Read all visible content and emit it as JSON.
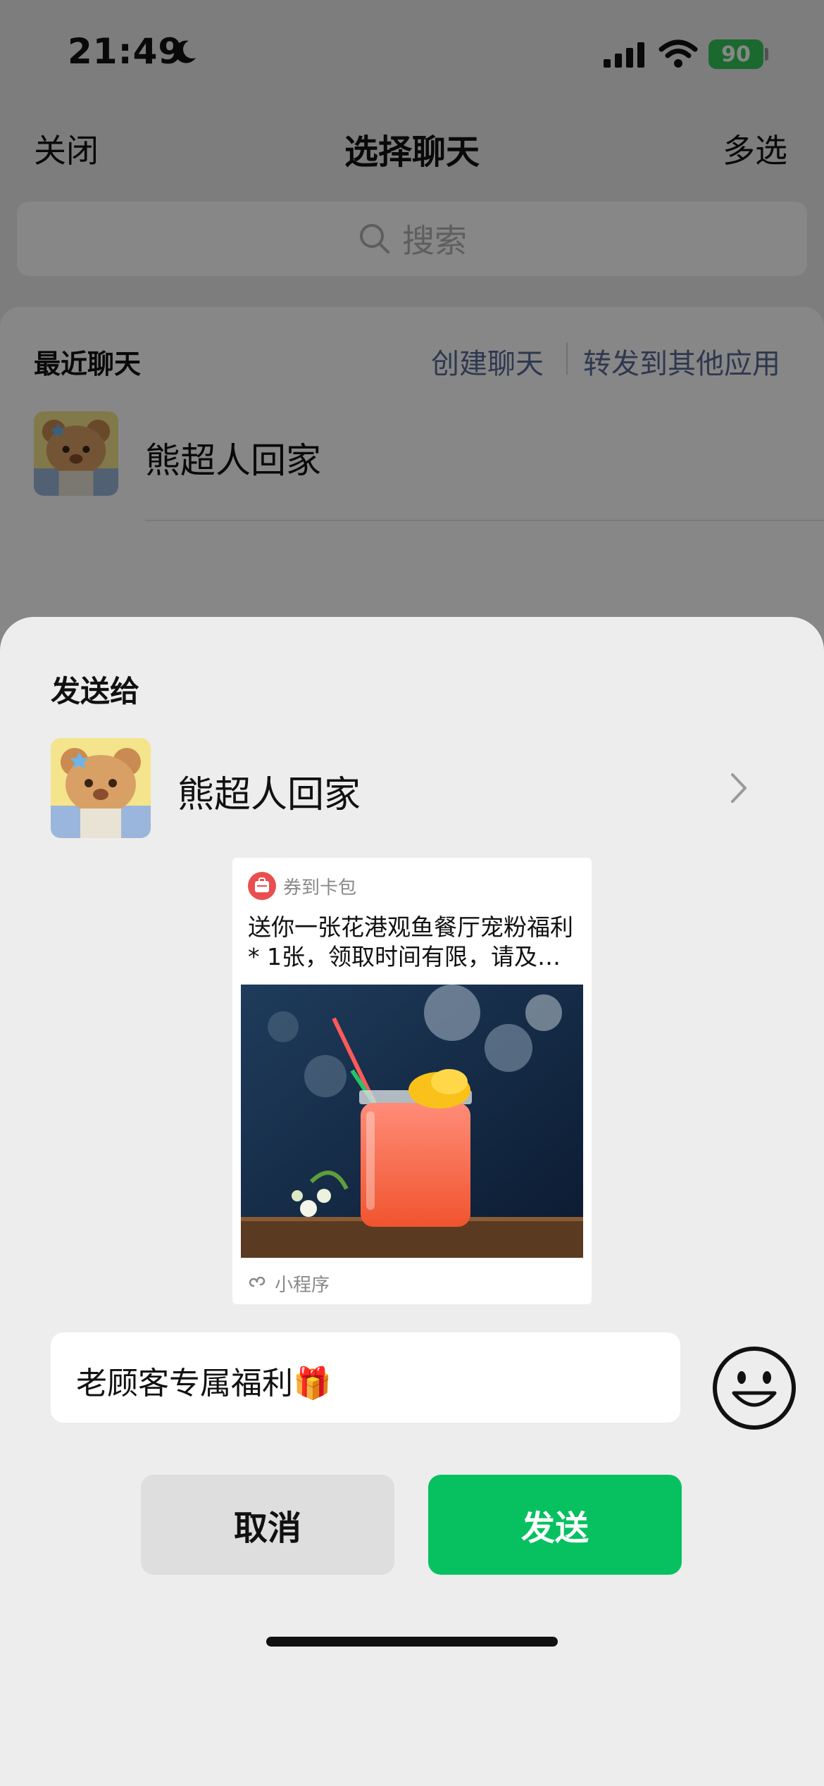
{
  "status_bar": {
    "time": "21:49",
    "battery": "90"
  },
  "nav": {
    "close": "关闭",
    "title": "选择聊天",
    "multi_select": "多选"
  },
  "search": {
    "placeholder": "搜索"
  },
  "recent": {
    "title": "最近聊天",
    "create_chat": "创建聊天",
    "forward_other": "转发到其他应用",
    "chats": [
      {
        "name": "熊超人回家"
      }
    ]
  },
  "sheet": {
    "send_to_label": "发送给",
    "recipient": {
      "name": "熊超人回家"
    },
    "card": {
      "app_name": "券到卡包",
      "description": "送你一张花港观鱼餐厅宠粉福利 * 1张，领取时间有限，请及…",
      "footer": "小程序"
    },
    "message": "老顾客专属福利🎁",
    "cancel_label": "取消",
    "send_label": "发送"
  },
  "colors": {
    "send_green": "#07c160",
    "link_blue": "#576b95",
    "battery_green": "#34c759",
    "card_icon_red": "#e94f4f"
  },
  "icons": [
    "moon-icon",
    "signal-icon",
    "wifi-icon",
    "search-icon",
    "chevron-right-icon",
    "coupon-icon",
    "mini-program-icon",
    "emoji-icon"
  ]
}
